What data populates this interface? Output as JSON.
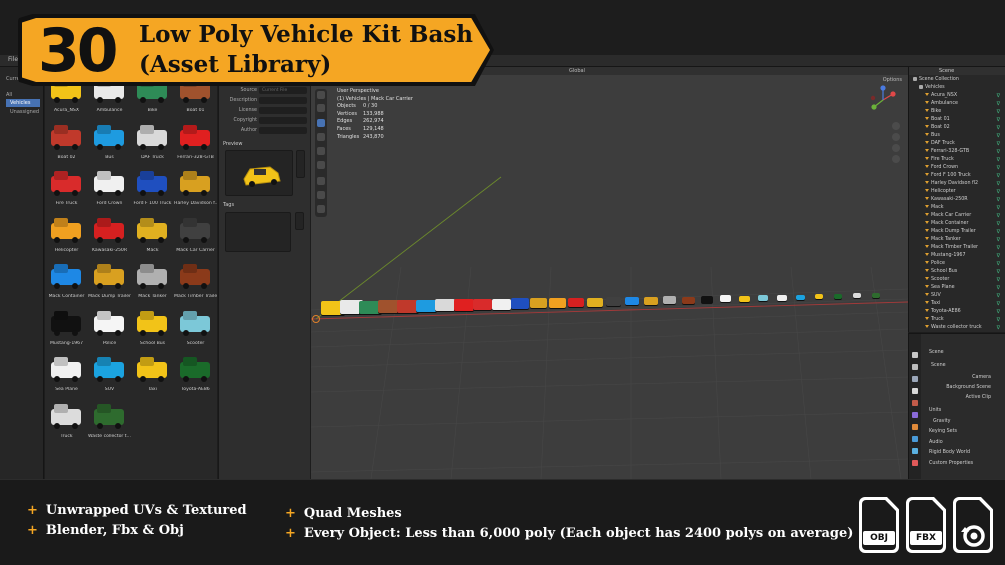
{
  "banner": {
    "number": "30",
    "title_line1": "Low Poly Vehicle Kit Bash",
    "title_line2": "(Asset Library)"
  },
  "topbar": {
    "menu": "File"
  },
  "left_sidebar": {
    "items": [
      "All",
      "Vehicles",
      "Unassigned"
    ],
    "header": "Current File"
  },
  "assets": [
    {
      "label": "Acura_NSX",
      "color": "#f2c318"
    },
    {
      "label": "Ambulance",
      "color": "#e9e9e9"
    },
    {
      "label": "Bike",
      "color": "#2e8b57"
    },
    {
      "label": "Boat 01",
      "color": "#a0522d"
    },
    {
      "label": "Boat 02",
      "color": "#c0392b"
    },
    {
      "label": "Bus",
      "color": "#1e9be0"
    },
    {
      "label": "DAF Truck",
      "color": "#d9d9d9"
    },
    {
      "label": "Ferrari-328-GTB",
      "color": "#e02020"
    },
    {
      "label": "Fire Truck",
      "color": "#d92b2b"
    },
    {
      "label": "Ford Crown",
      "color": "#f0f0f0"
    },
    {
      "label": "Ford F 100 Truck",
      "color": "#1f4fbf"
    },
    {
      "label": "Harley Davidson f...",
      "color": "#d8a020"
    },
    {
      "label": "Helicopter",
      "color": "#f0a020"
    },
    {
      "label": "Kawasaki-250R",
      "color": "#d62020"
    },
    {
      "label": "Mack",
      "color": "#e0b020"
    },
    {
      "label": "Mack Car Carrier",
      "color": "#404040"
    },
    {
      "label": "Mack Container",
      "color": "#1e88e5"
    },
    {
      "label": "Mack Dump Trailer",
      "color": "#d9a020"
    },
    {
      "label": "Mack Tanker",
      "color": "#b0b0b0"
    },
    {
      "label": "Mack Timber Trailer",
      "color": "#8b3a1a"
    },
    {
      "label": "Mustang-1967",
      "color": "#111111"
    },
    {
      "label": "Police",
      "color": "#f5f5f5"
    },
    {
      "label": "School Bus",
      "color": "#f2c318"
    },
    {
      "label": "Scooter",
      "color": "#7cc8d8"
    },
    {
      "label": "Sea Plane",
      "color": "#f0f0f0"
    },
    {
      "label": "SUV",
      "color": "#1ba3e0"
    },
    {
      "label": "Taxi",
      "color": "#f2c318"
    },
    {
      "label": "Toyota-AE86",
      "color": "#1a6b2a"
    },
    {
      "label": "Truck",
      "color": "#dcdcdc"
    },
    {
      "label": "Waste collector t...",
      "color": "#2e6b2e"
    }
  ],
  "metadata": {
    "fields": [
      {
        "key": "Source",
        "value": "Current File"
      },
      {
        "key": "Description",
        "value": ""
      },
      {
        "key": "License",
        "value": ""
      },
      {
        "key": "Copyright",
        "value": ""
      },
      {
        "key": "Author",
        "value": ""
      }
    ],
    "preview_label": "Preview",
    "tags_label": "Tags"
  },
  "viewport": {
    "header_left": "Global",
    "options": "Options",
    "perspective": "User Perspective",
    "collection": "(1) Vehicles | Mack Car Carrier",
    "stats": [
      {
        "key": "Objects",
        "value": "0 / 30"
      },
      {
        "key": "Vertices",
        "value": "133,988"
      },
      {
        "key": "Edges",
        "value": "262,974"
      },
      {
        "key": "Faces",
        "value": "129,148"
      },
      {
        "key": "Triangles",
        "value": "243,870"
      }
    ]
  },
  "outliner": {
    "header": "Scene",
    "scene_collection": "Scene Collection",
    "collection": "Vehicles",
    "items": [
      "Acura_NSX",
      "Ambulance",
      "Bike",
      "Boat 01",
      "Boat 02",
      "Bus",
      "DAF Truck",
      "Ferrari-328-GTB",
      "Fire Truck",
      "Ford Crown",
      "Ford F 100 Truck",
      "Harley Davidson fl2",
      "Helicopter",
      "Kawasaki-250R",
      "Mack",
      "Mack Car Carrier",
      "Mack Container",
      "Mack Dump Trailer",
      "Mack Tanker",
      "Mack Timber Trailer",
      "Mustang-1967",
      "Police",
      "School Bus",
      "Scooter",
      "Sea Plane",
      "SUV",
      "Taxi",
      "Toyota-AE86",
      "Truck",
      "Waste collector truck"
    ]
  },
  "properties": {
    "header": "Scene",
    "section": "Scene",
    "rows": [
      "Camera",
      "Background Scene",
      "Active Clip"
    ],
    "subsections": [
      "Units",
      "Gravity",
      "Keying Sets",
      "Audio",
      "Rigid Body World",
      "Custom Properties"
    ]
  },
  "features": {
    "left": [
      "Unwrapped UVs & Textured",
      "Blender, Fbx & Obj"
    ],
    "right": [
      "Quad Meshes",
      "Every Object: Less than 6,000 poly (Each object has 2400 polys on average)"
    ]
  },
  "formats": [
    "OBJ",
    "FBX"
  ]
}
